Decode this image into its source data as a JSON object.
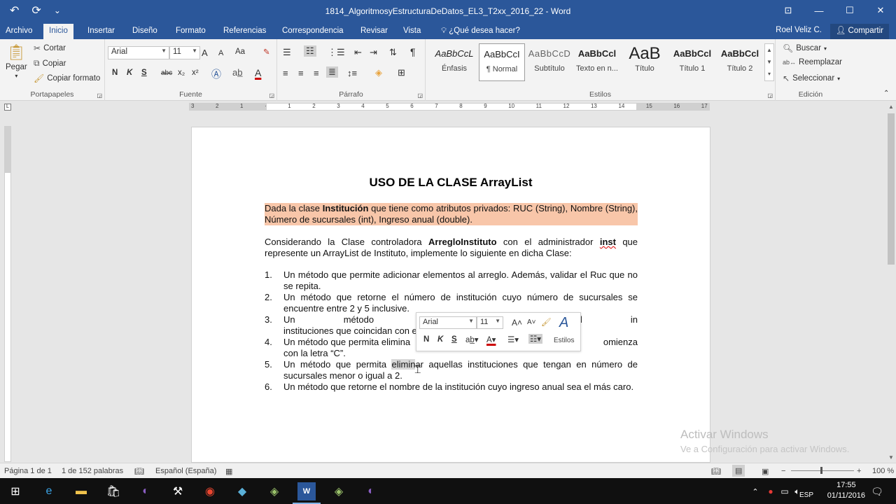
{
  "window": {
    "title": "1814_AlgoritmosyEstructuraDeDatos_EL3_T2xx_2016_22 - Word",
    "qat": {
      "undo_icon": "↶",
      "redo_icon": "⟳",
      "customize_icon": "⌄"
    },
    "controls": {
      "ribbon_options": "⊡",
      "minimize": "—",
      "maximize": "☐",
      "close": "✕"
    }
  },
  "tabs": {
    "file": "Archivo",
    "home": "Inicio",
    "insert": "Insertar",
    "design": "Diseño",
    "format": "Formato",
    "references": "Referencias",
    "mailings": "Correspondencia",
    "review": "Revisar",
    "view": "Vista",
    "tell_me": "¿Qué desea hacer?",
    "user": "Roel Veliz C.",
    "share": "Compartir"
  },
  "ribbon": {
    "clipboard": {
      "label": "Portapapeles",
      "paste": "Pegar",
      "cut": "Cortar",
      "copy": "Copiar",
      "format_painter": "Copiar formato"
    },
    "font": {
      "label": "Fuente",
      "font_name": "Arial",
      "font_size": "11",
      "bold": "N",
      "italic": "K",
      "underline": "S",
      "strikethrough": "abc",
      "subscript": "x₂",
      "superscript": "x²",
      "case": "Aa",
      "grow": "A",
      "shrink": "A"
    },
    "paragraph": {
      "label": "Párrafo"
    },
    "styles": {
      "label": "Estilos",
      "items": [
        {
          "preview": "AaBbCcL",
          "name": "Énfasis"
        },
        {
          "preview": "AaBbCcI",
          "name": "¶ Normal"
        },
        {
          "preview": "AaBbCcD",
          "name": "Subtítulo"
        },
        {
          "preview": "AaBbCcl",
          "name": "Texto en n..."
        },
        {
          "preview": "AaB",
          "name": "Título"
        },
        {
          "preview": "AaBbCcl",
          "name": "Título 1"
        },
        {
          "preview": "AaBbCcl",
          "name": "Título 2"
        }
      ]
    },
    "editing": {
      "label": "Edición",
      "find": "Buscar",
      "replace": "Reemplazar",
      "select": "Seleccionar"
    }
  },
  "ruler": {
    "ticks": [
      "3",
      "2",
      "1",
      "",
      "1",
      "2",
      "3",
      "4",
      "5",
      "6",
      "7",
      "8",
      "9",
      "10",
      "11",
      "12",
      "13",
      "14",
      "15",
      "16",
      "17"
    ]
  },
  "document": {
    "title": "USO DE LA CLASE ArrayList",
    "para1": {
      "pre": "Dada la clase ",
      "bold": "Institución",
      "post": " que tiene como atributos privados: RUC (String), Nombre (String), Número de sucursales (int), Ingreso anual (double)."
    },
    "para2": {
      "pre": "Considerando la Clase controladora ",
      "bold": "ArregloInstituto",
      "mid": " con el administrador ",
      "bold2": "inst",
      "post": " que represente un ArrayList de Instituto, implemente lo siguiente en dicha Clase:"
    },
    "tasks": [
      {
        "num": "1.",
        "text": "Un método que permite adicionar elementos al arreglo. Además, validar el Ruc que no se repita."
      },
      {
        "num": "2.",
        "text": "Un método que retorne el número de institución cuyo número de sucursales se encuentre entre 2 y 5 inclusive."
      },
      {
        "num": "3.",
        "text": "Un método que disminuya el in                                                                          instituciones que coincidan con el nombre."
      },
      {
        "num": "4.",
        "text": "Un método que permita elimina                                                                          omienza con la letra “C”."
      },
      {
        "num": "5.",
        "pre": "Un método que permita ",
        "hl": "elimin",
        "post": "ar aquellas instituciones que tengan en número de sucursales menor o igual a 2."
      },
      {
        "num": "6.",
        "text": "Un método que retorne el nombre de la institución cuyo ingreso anual sea el más caro."
      }
    ]
  },
  "mini_toolbar": {
    "font_name": "Arial",
    "font_size": "11",
    "bold": "N",
    "italic": "K",
    "underline": "S",
    "styles_label": "Estilos"
  },
  "watermark": {
    "line1": "Activar Windows",
    "line2": "Ve a Configuración para activar Windows."
  },
  "statusbar": {
    "page": "Página 1 de 1",
    "words": "1 de 152 palabras",
    "language": "Español (España)",
    "zoom_minus": "−",
    "zoom_plus": "+",
    "zoom": "100 %"
  },
  "taskbar": {
    "language": "ESP",
    "time": "17:55",
    "date": "01/11/2016"
  }
}
